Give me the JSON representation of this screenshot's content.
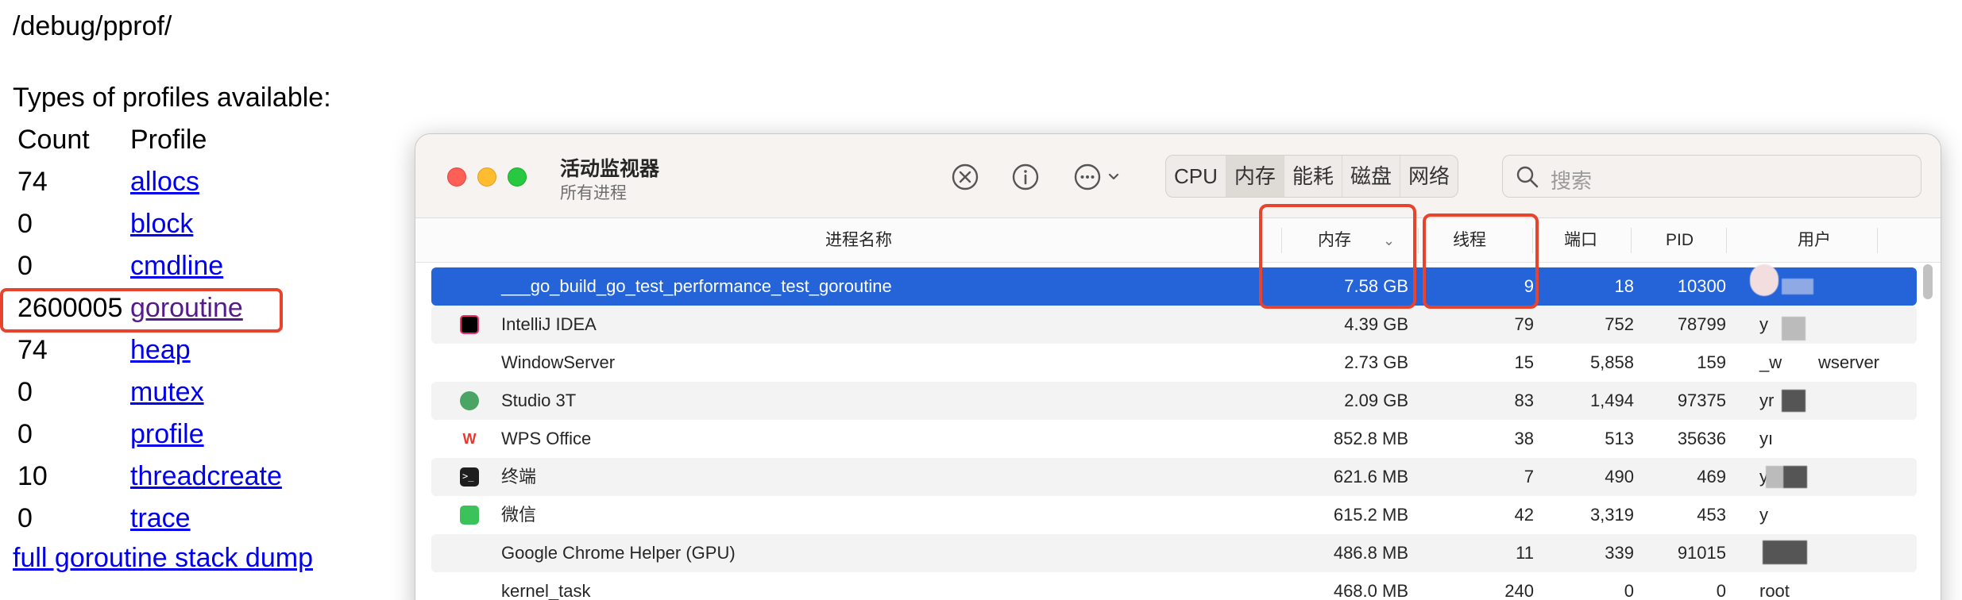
{
  "pprof": {
    "path": "/debug/pprof/",
    "types_heading": "Types of profiles available:",
    "header": {
      "count": "Count",
      "profile": "Profile"
    },
    "rows": [
      {
        "count": "74",
        "profile": "allocs"
      },
      {
        "count": "0",
        "profile": "block"
      },
      {
        "count": "0",
        "profile": "cmdline"
      },
      {
        "count": "2600005",
        "profile": "goroutine"
      },
      {
        "count": "74",
        "profile": "heap"
      },
      {
        "count": "0",
        "profile": "mutex"
      },
      {
        "count": "0",
        "profile": "profile"
      },
      {
        "count": "10",
        "profile": "threadcreate"
      },
      {
        "count": "0",
        "profile": "trace"
      }
    ],
    "full_dump_link": "full goroutine stack dump",
    "highlight_color": "#e8442d"
  },
  "activity_monitor": {
    "title": "活动监视器",
    "subtitle": "所有进程",
    "toolbar": {
      "stop_icon": "x-circle-icon",
      "info_icon": "info-circle-icon",
      "more_icon": "ellipsis-circle-icon"
    },
    "tabs": [
      "CPU",
      "内存",
      "能耗",
      "磁盘",
      "网络"
    ],
    "active_tab": "内存",
    "search_placeholder": "搜索",
    "columns": {
      "name": "进程名称",
      "memory": "内存",
      "threads": "线程",
      "ports": "端口",
      "pid": "PID",
      "user": "用户"
    },
    "selection_color": "#2463d8",
    "rows": [
      {
        "name": "___go_build_go_test_performance_test_goroutine",
        "memory": "7.58 GB",
        "threads": "9",
        "ports": "18",
        "pid": "10300",
        "user": "",
        "icon": "none"
      },
      {
        "name": "IntelliJ IDEA",
        "memory": "4.39 GB",
        "threads": "79",
        "ports": "752",
        "pid": "78799",
        "user": "y",
        "icon": "intellij-icon"
      },
      {
        "name": "WindowServer",
        "memory": "2.73 GB",
        "threads": "15",
        "ports": "5,858",
        "pid": "159",
        "user": "_w",
        "user2": "wserver",
        "icon": "none"
      },
      {
        "name": "Studio 3T",
        "memory": "2.09 GB",
        "threads": "83",
        "ports": "1,494",
        "pid": "97375",
        "user": "yr",
        "icon": "studio3t-icon"
      },
      {
        "name": "WPS Office",
        "memory": "852.8 MB",
        "threads": "38",
        "ports": "513",
        "pid": "35636",
        "user": "yı",
        "icon": "wps-icon"
      },
      {
        "name": "终端",
        "memory": "621.6 MB",
        "threads": "7",
        "ports": "490",
        "pid": "469",
        "user": "y",
        "icon": "terminal-icon"
      },
      {
        "name": "微信",
        "memory": "615.2 MB",
        "threads": "42",
        "ports": "3,319",
        "pid": "453",
        "user": "y",
        "icon": "wechat-icon"
      },
      {
        "name": "Google Chrome Helper (GPU)",
        "memory": "486.8 MB",
        "threads": "11",
        "ports": "339",
        "pid": "91015",
        "user": "",
        "icon": "none"
      },
      {
        "name": "kernel_task",
        "memory": "468.0 MB",
        "threads": "240",
        "ports": "0",
        "pid": "0",
        "user": "root",
        "icon": "none"
      }
    ]
  }
}
